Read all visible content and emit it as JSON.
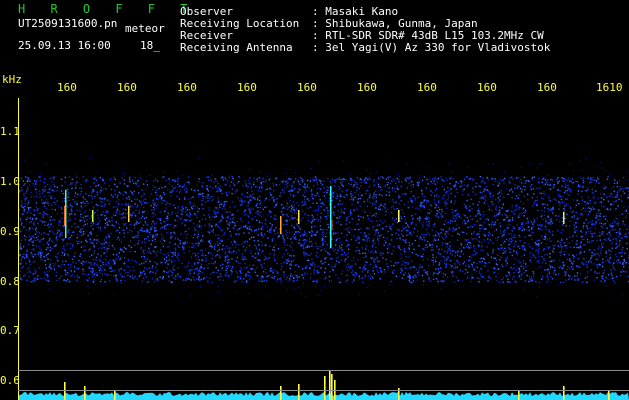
{
  "header": {
    "app_title": "H R O F F T",
    "file_name": "UT2509131600.pn",
    "mode_label": "meteor",
    "datetime": "25.09.13 16:00",
    "count": "18_",
    "fields": [
      {
        "label": "Observer",
        "value": ": Masaki Kano"
      },
      {
        "label": "Receiving Location",
        "value": ": Shibukawa, Gunma, Japan"
      },
      {
        "label": "Receiver",
        "value": ": RTL-SDR SDR# 43dB L15 103.2MHz CW"
      },
      {
        "label": "Receiving Antenna",
        "value": ": 3el Yagi(V) Az 330 for Vladivostok"
      }
    ]
  },
  "axes": {
    "y_unit": "kHz",
    "x_ticks": [
      "160",
      "160",
      "160",
      "160",
      "160",
      "160",
      "160",
      "160",
      "160",
      "1610"
    ],
    "y_ticks": [
      "1.1",
      "1.0",
      "0.9",
      "0.8",
      "0.7",
      "0.6"
    ]
  },
  "colors": {
    "title_green": "#22c832",
    "axis_yellow": "#ffff3c",
    "noise_blue": "#1a3cff",
    "trace_cyan": "#22d8ff"
  }
}
